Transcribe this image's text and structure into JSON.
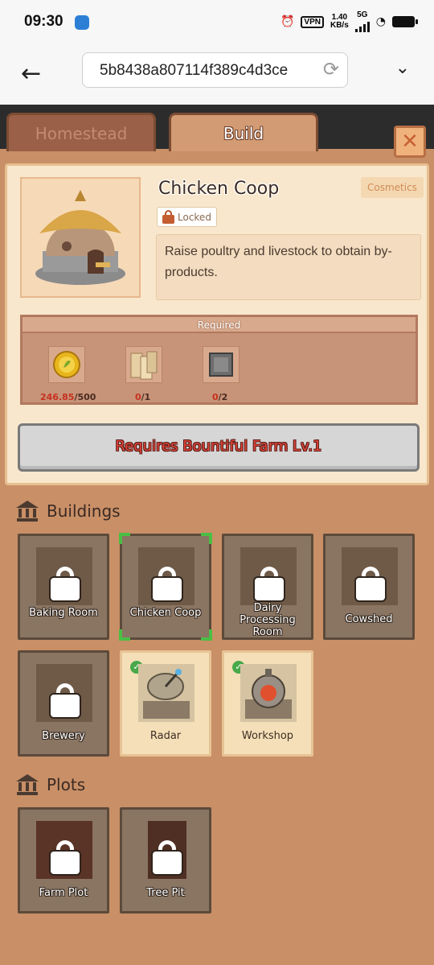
{
  "status_bar": {
    "time": "09:30",
    "vpn": "VPN",
    "speed_value": "1.40",
    "speed_unit": "KB/s",
    "network": "5G"
  },
  "browser": {
    "url": "5b8438a807114f389c4d3ce"
  },
  "tabs": [
    {
      "label": "Homestead",
      "active": false
    },
    {
      "label": "Build",
      "active": true
    }
  ],
  "detail": {
    "title": "Chicken Coop",
    "status": "Locked",
    "tag": "Cosmetics",
    "description": "Raise poultry and livestock to obtain by-products.",
    "required_label": "Required",
    "requirements": [
      {
        "icon": "gold-coin-icon",
        "have": "246.85",
        "need": "/500"
      },
      {
        "icon": "wood-plank-icon",
        "have": "0",
        "need": "/1"
      },
      {
        "icon": "stone-block-icon",
        "have": "0",
        "need": "/2"
      }
    ],
    "action_label": "Requires Bountiful Farm Lv.1"
  },
  "buildings": {
    "heading": "Buildings",
    "items": [
      {
        "label": "Baking Room",
        "state": "locked"
      },
      {
        "label": "Chicken Coop",
        "state": "locked",
        "selected": true
      },
      {
        "label": "Dairy Processing Room",
        "state": "locked"
      },
      {
        "label": "Cowshed",
        "state": "locked"
      },
      {
        "label": "Brewery",
        "state": "locked"
      },
      {
        "label": "Radar",
        "state": "available"
      },
      {
        "label": "Workshop",
        "state": "available"
      }
    ]
  },
  "plots": {
    "heading": "Plots",
    "items": [
      {
        "label": "Farm Plot",
        "state": "locked"
      },
      {
        "label": "Tree Pit",
        "state": "locked"
      }
    ]
  },
  "colors": {
    "panel_bg": "#c98f66",
    "card_bg": "#f8e7cc",
    "warning_text": "#e0443a",
    "selected_corner": "#4bbe44",
    "available_check": "#48a84a"
  }
}
